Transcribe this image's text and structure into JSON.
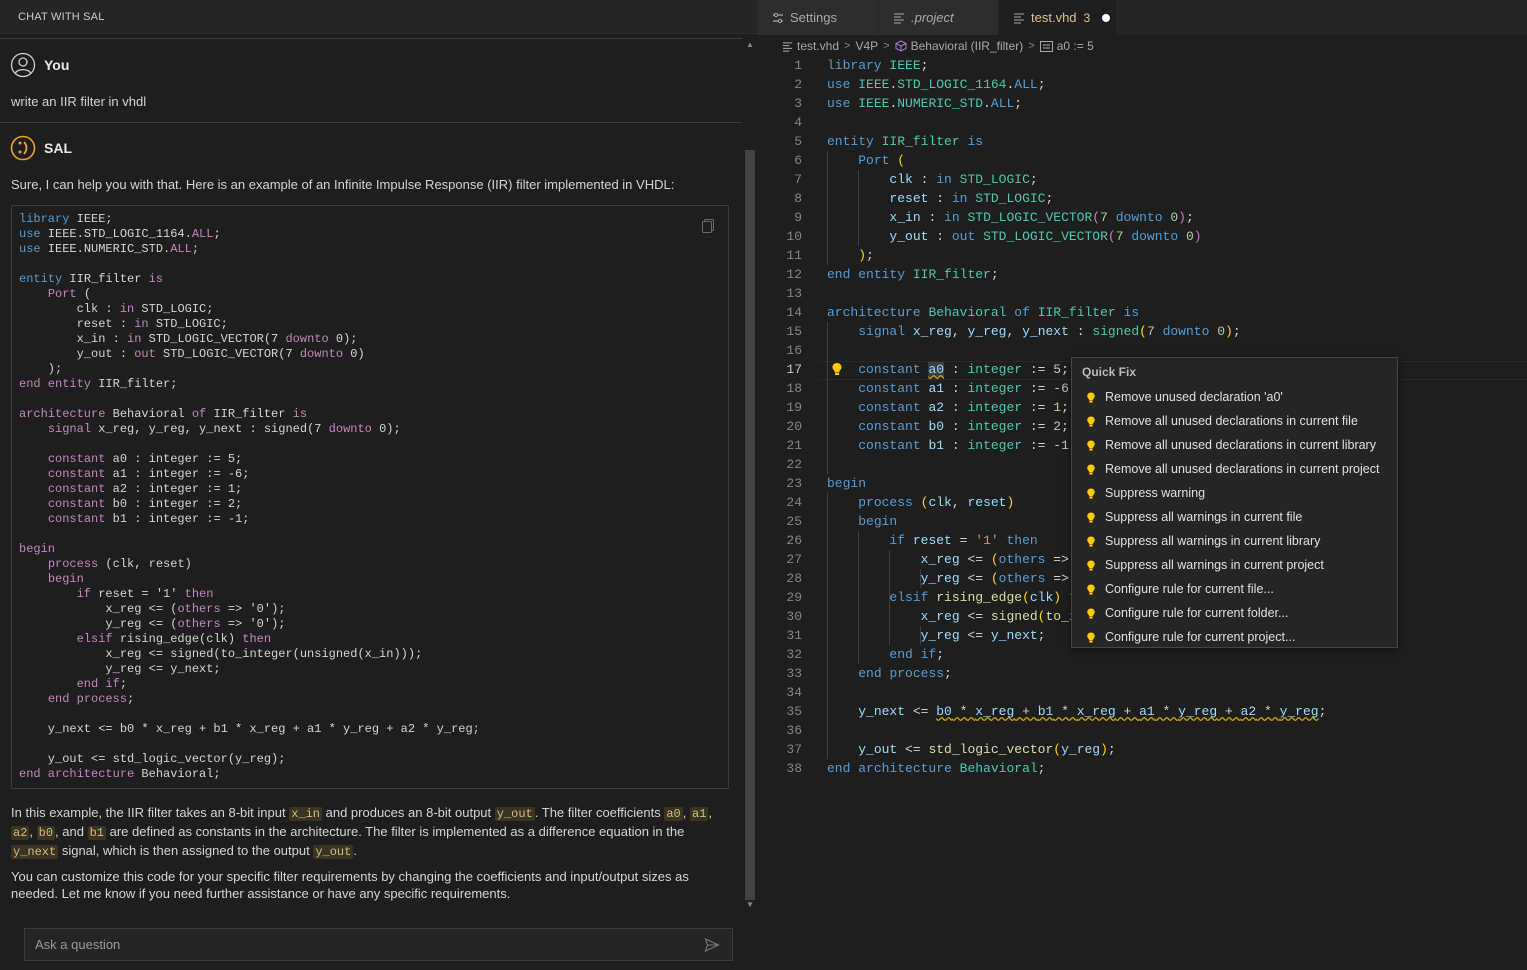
{
  "chat": {
    "header_title": "CHAT WITH SAL",
    "user_name": "You",
    "user_message": "write an IIR filter in vhdl",
    "bot_name": "SAL",
    "bot_intro": "Sure, I can help you with that. Here is an example of an Infinite Impulse Response (IIR) filter implemented in VHDL:",
    "explain": {
      "t1": "In this example, the IIR filter takes an 8-bit input ",
      "c1": "x_in",
      "t2": " and produces an 8-bit output ",
      "c2": "y_out",
      "t3": ". The filter coefficients ",
      "c3": "a0",
      "t4": ", ",
      "c4": "a1",
      "t5": ", ",
      "c5": "a2",
      "t6": ", ",
      "c6": "b0",
      "t7": ", and ",
      "c7": "b1",
      "t8": " are defined as constants in the architecture. The filter is implemented as a difference equation in the ",
      "c8": "y_next",
      "t9": " signal, which is then assigned to the output ",
      "c9": "y_out",
      "t10": "."
    },
    "closing": "You can customize this code for your specific filter requirements by changing the coefficients and input/output sizes as needed. Let me know if you need further assistance or have any specific requirements.",
    "ask_placeholder": "Ask a question"
  },
  "tabs": [
    {
      "label": "Settings",
      "icon": "settings-icon"
    },
    {
      "label": ".project",
      "icon": "file-lines-icon"
    },
    {
      "label": "test.vhd",
      "icon": "file-lines-icon",
      "count": "3",
      "active": true,
      "modified": true
    }
  ],
  "breadcrumb": {
    "file": "test.vhd",
    "project": "V4P",
    "architecture": "Behavioral (IIR_filter)",
    "symbol": "a0 := 5"
  },
  "editor": {
    "current_line": 17,
    "line_numbers": [
      "1",
      "2",
      "3",
      "4",
      "5",
      "6",
      "7",
      "8",
      "9",
      "10",
      "11",
      "12",
      "13",
      "14",
      "15",
      "16",
      "17",
      "18",
      "19",
      "20",
      "21",
      "22",
      "23",
      "24",
      "25",
      "26",
      "27",
      "28",
      "29",
      "30",
      "31",
      "32",
      "33",
      "34",
      "35",
      "36",
      "37",
      "38"
    ]
  },
  "quick_fix": {
    "title": "Quick Fix",
    "items": [
      "Remove unused declaration 'a0'",
      "Remove all unused declarations in current file",
      "Remove all unused declarations in current library",
      "Remove all unused declarations in current project",
      "Suppress warning",
      "Suppress all warnings in current file",
      "Suppress all warnings in current library",
      "Suppress all warnings in current project",
      "Configure rule for current file...",
      "Configure rule for current folder...",
      "Configure rule for current project..."
    ]
  },
  "colors": {
    "accent_tab": "#e2c08d",
    "lightbulb": "#ffcc00",
    "keyword": "#569cd6",
    "type": "#4ec9b0"
  }
}
